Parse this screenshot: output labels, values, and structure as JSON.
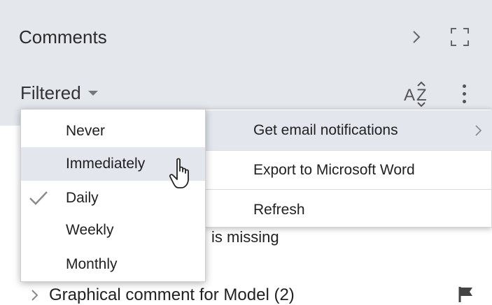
{
  "header": {
    "title": "Comments",
    "filter_label": "Filtered",
    "sort_icon": "sort-az-icon",
    "more_icon": "kebab-menu-icon"
  },
  "menu": {
    "items": [
      {
        "label": "Get email notifications",
        "has_submenu": true
      },
      {
        "label": "Export to Microsoft Word"
      },
      {
        "label": "Refresh"
      }
    ]
  },
  "submenu": {
    "items": [
      {
        "label": "Never",
        "checked": false
      },
      {
        "label": "Immediately",
        "checked": false,
        "hovered": true
      },
      {
        "label": "Daily",
        "checked": true
      },
      {
        "label": "Weekly",
        "checked": false
      },
      {
        "label": "Monthly",
        "checked": false
      }
    ]
  },
  "background": {
    "partial_text": "is missing",
    "row_label": "Graphical comment for Model (2)"
  },
  "colors": {
    "header_bg": "#e4e7ec",
    "hover_bg": "#e3e7ed"
  }
}
